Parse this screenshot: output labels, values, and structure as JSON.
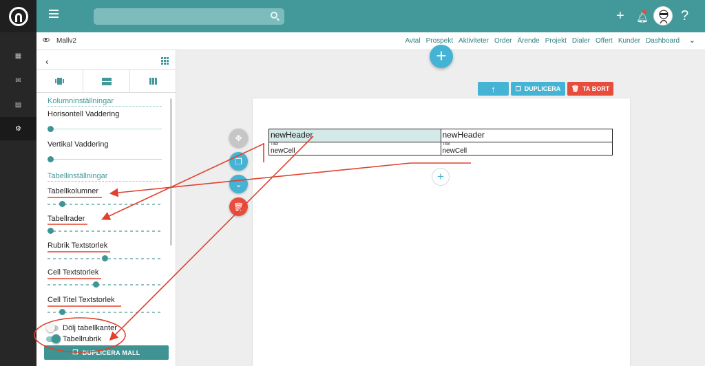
{
  "search": {
    "placeholder": ""
  },
  "subbar": {
    "template_name": "Mallv2",
    "modules": [
      "Avtal",
      "Prospekt",
      "Aktiviteter",
      "Order",
      "Ärende",
      "Projekt",
      "Dialer",
      "Offert",
      "Kunder",
      "Dashboard"
    ]
  },
  "panel": {
    "section_column": "Kolumninställningar",
    "horiz_padding": "Horisontell Vaddering",
    "vert_padding": "Vertikal Vaddering",
    "section_table": "Tabellinställningar",
    "table_columns": "Tabellkolumner",
    "table_rows": "Tabellrader",
    "header_textsize": "Rubrik Textstorlek",
    "cell_textsize": "Cell Textstorlek",
    "cell_title_textsize": "Cell Titel Textstorlek",
    "hide_borders": "Dölj tabellkanter",
    "table_header": "Tabellrubrik",
    "duplicate_template": "DUPLICERA MALL",
    "slider_levels": {
      "horiz_padding": 0.0,
      "vert_padding": 0.0,
      "table_columns": 0.11,
      "table_rows": 0.0,
      "header_textsize": 0.5,
      "cell_textsize": 0.42,
      "cell_title_textsize": 0.11
    },
    "toggles": {
      "hide_borders": false,
      "table_header": true
    }
  },
  "canvas": {
    "duplicate_label": "DUPLICERA",
    "delete_label": "TA BORT",
    "table": {
      "headers": [
        "newHeader",
        "newHeader"
      ],
      "cells": [
        {
          "title": "Titel",
          "value": "newCell"
        },
        {
          "title": "Titel",
          "value": "newCell"
        }
      ]
    }
  },
  "colors": {
    "brand": "#43999a",
    "accent_blue": "#45b3d3",
    "danger": "#e74c3c",
    "annotation": "#e2402a"
  }
}
